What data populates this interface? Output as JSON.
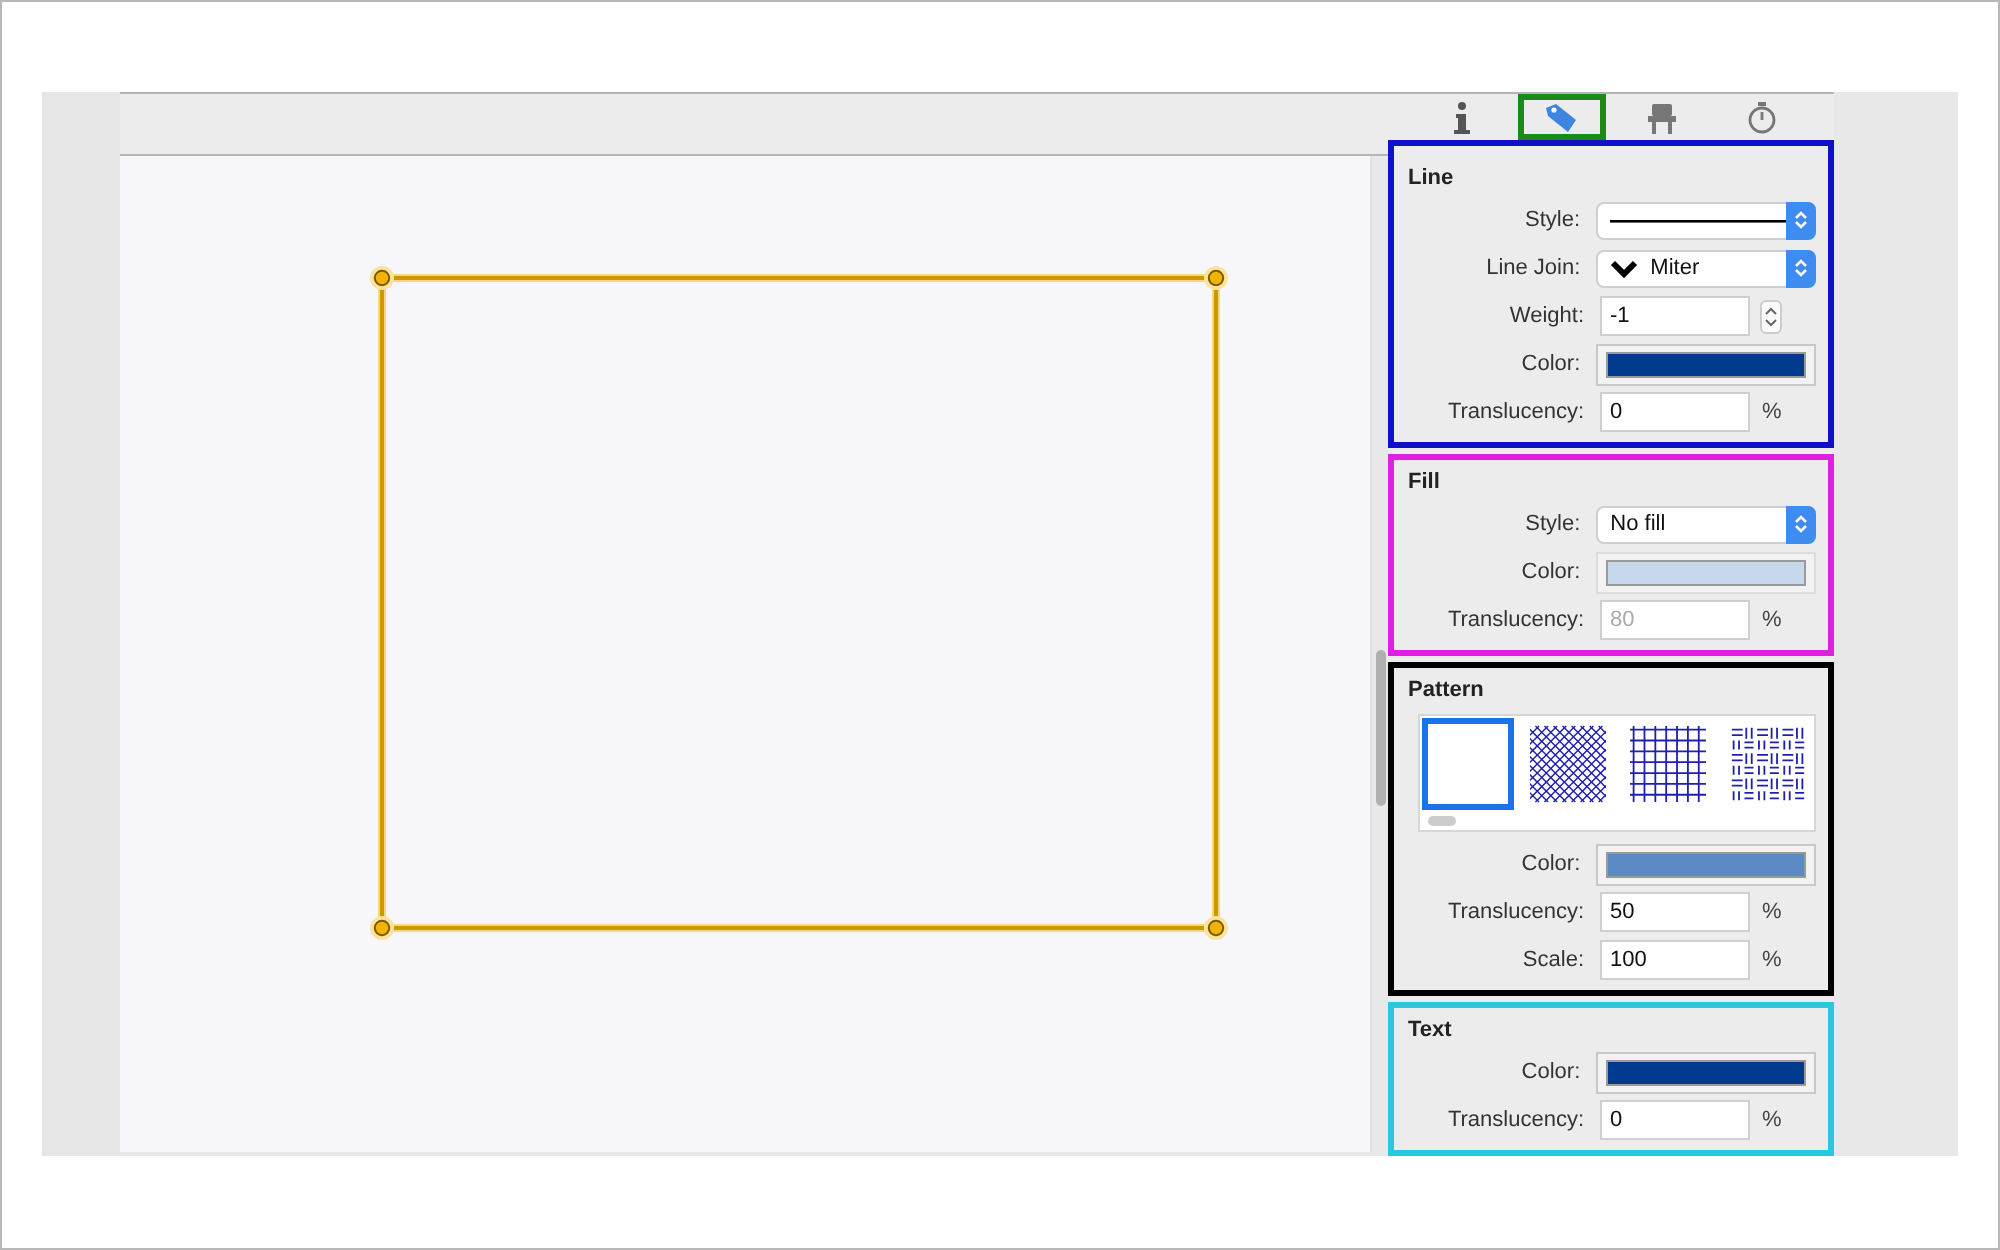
{
  "tabs": [
    {
      "selected": false
    },
    {
      "selected": true
    },
    {
      "selected": false
    },
    {
      "selected": false
    }
  ],
  "sections": [
    {
      "title": "Line",
      "color": "#1010c8",
      "rows": [
        {
          "kind": "line-popup",
          "label": "Style:",
          "disabled": false
        },
        {
          "kind": "popup",
          "label": "Line Join:",
          "value": "Miter",
          "disabled": false
        },
        {
          "kind": "stepper",
          "label": "Weight:",
          "value": "-1",
          "disabled": false
        },
        {
          "kind": "color",
          "label": "Color:",
          "color": "#003a8c",
          "disabled": false
        },
        {
          "kind": "percent",
          "label": "Translucency:",
          "value": "0",
          "unit": "%",
          "disabled": false
        }
      ]
    },
    {
      "title": "Fill",
      "color": "#e020e0",
      "rows": [
        {
          "kind": "popup",
          "label": "Style:",
          "value": "No fill",
          "disabled": false
        },
        {
          "kind": "color",
          "label": "Color:",
          "color": "#c8d8ec",
          "disabled": true
        },
        {
          "kind": "percent",
          "label": "Translucency:",
          "value": "80",
          "unit": "%",
          "disabled": true
        }
      ]
    },
    {
      "title": "Pattern",
      "color": "#000000",
      "swatches": [
        {
          "kind": "blank",
          "selected": true
        },
        {
          "kind": "diamond",
          "selected": false
        },
        {
          "kind": "grid",
          "selected": false
        },
        {
          "kind": "weave",
          "selected": false
        }
      ],
      "rows": [
        {
          "kind": "color",
          "label": "Color:",
          "color": "#5b8ac4",
          "disabled": false
        },
        {
          "kind": "percent",
          "label": "Translucency:",
          "value": "50",
          "unit": "%",
          "disabled": false
        },
        {
          "kind": "percent",
          "label": "Scale:",
          "value": "100",
          "unit": "%",
          "disabled": false
        }
      ]
    },
    {
      "title": "Text",
      "color": "#28c8e0",
      "rows": [
        {
          "kind": "color",
          "label": "Color:",
          "color": "#003a8c",
          "disabled": false
        },
        {
          "kind": "percent",
          "label": "Translucency:",
          "value": "0",
          "unit": "%",
          "disabled": false
        }
      ]
    }
  ]
}
